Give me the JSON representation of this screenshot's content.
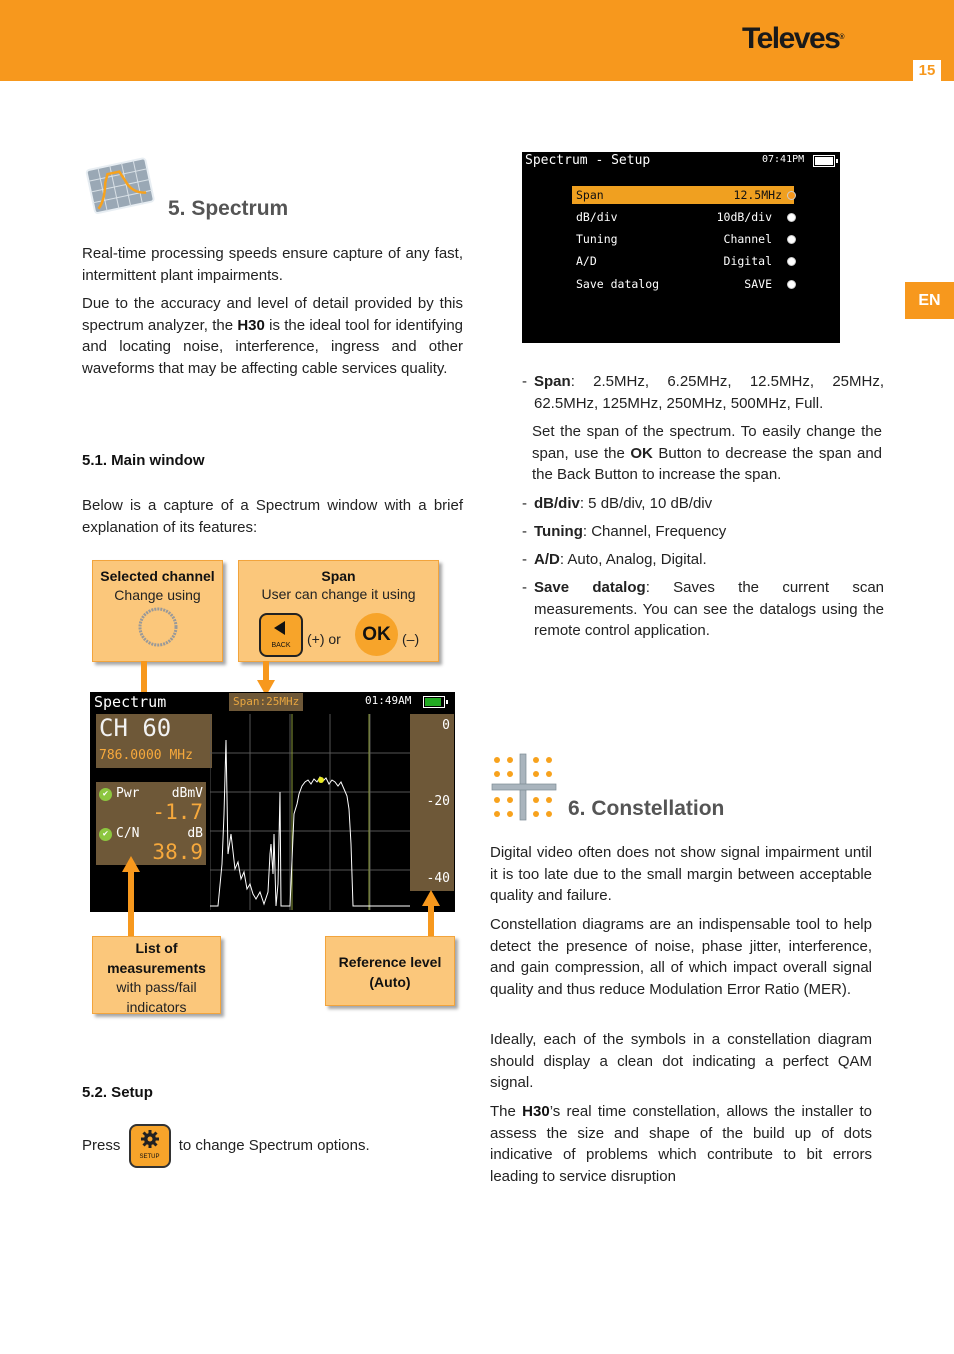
{
  "header": {
    "brand": "Televes",
    "registered": "®",
    "page_number": "15",
    "lang_tab": "EN",
    "accent_color": "#f7981d"
  },
  "section5": {
    "icon": "spectrum-icon",
    "title": "5. Spectrum",
    "para1": "Real-time processing speeds ensure capture of any fast, intermittent plant impairments.",
    "para2_pre": "Due to the accuracy and level of detail provided by this spectrum analyzer, the ",
    "para2_bold": "H30",
    "para2_post": " is the ideal tool for identifying and locating noise, interference, ingress and other waveforms that may be affecting cable services quality.",
    "sub1_title": "5.1. Main window",
    "sub1_text": "Below is a capture of a Spectrum window with a brief explanation of its features:",
    "callouts": {
      "selected_channel_title": "Selected channel",
      "selected_channel_text": "Change using",
      "span_title": "Span",
      "span_text": "User can change it using",
      "back_label": "BACK",
      "plus": "(+) or",
      "ok_label": "OK",
      "minus": "(–)",
      "list_title": "List of measurements",
      "list_text": "with pass/fail indicators",
      "ref_title": "Reference level (Auto)"
    },
    "screen": {
      "title": "Spectrum",
      "span": "Span:25MHz",
      "time": "01:49AM",
      "channel": "CH 60",
      "frequency": "786.0000 MHz",
      "pwr_label": "Pwr",
      "pwr_unit": "dBmV",
      "pwr_value": "-1.7",
      "cn_label": "C/N",
      "cn_unit": "dB",
      "cn_value": "38.9",
      "ref_levels": [
        "0",
        "-20",
        "-40"
      ]
    },
    "sub2_title": "5.2. Setup",
    "sub2_pre": "Press",
    "setup_key_label": "SETUP",
    "sub2_post": "to change Spectrum options."
  },
  "setup_screen": {
    "title": "Spectrum - Setup",
    "time": "07:41PM",
    "rows": [
      {
        "label": "Span",
        "value": "12.5MHz",
        "selected": true
      },
      {
        "label": "dB/div",
        "value": "10dB/div",
        "selected": false
      },
      {
        "label": "Tuning",
        "value": "Channel",
        "selected": false
      },
      {
        "label": "A/D",
        "value": "Digital",
        "selected": false
      },
      {
        "label": "Save datalog",
        "value": "SAVE",
        "selected": false
      }
    ]
  },
  "options": {
    "span_label": "Span",
    "span_text": ": 2.5MHz, 6.25MHz, 12.5MHz, 25MHz, 62.5MHz, 125MHz, 250MHz, 500MHz, Full.",
    "span_note_pre": "Set the span of the spectrum. To easily change the span, use the ",
    "span_note_bold": "OK",
    "span_note_post": " Button to decrease the span and the Back Button to increase the span.",
    "dbdiv_label": "dB/div",
    "dbdiv_text": ": 5 dB/div, 10 dB/div",
    "tuning_label": "Tuning",
    "tuning_text": ": Channel, Frequency",
    "ad_label": "A/D",
    "ad_text": ": Auto, Analog, Digital.",
    "save_label": "Save datalog",
    "save_text": ": Saves the current scan measurements. You can see the datalogs using the remote control application."
  },
  "section6": {
    "icon": "constellation-icon",
    "title": "6. Constellation",
    "para1": "Digital video often does not show signal impairment until it is too late due to the small margin between acceptable quality and failure.",
    "para2": "Constellation diagrams are an indispensable tool to help detect the presence of noise, phase jitter, interference, and gain compression, all of which impact overall signal quality and thus reduce Modulation Error Ratio (MER).",
    "para3": "Ideally, each of the symbols in a constellation diagram should display a clean dot indicating a perfect QAM signal.",
    "para4_pre": "The ",
    "para4_bold": "H30",
    "para4_post": "’s real time constellation, allows the installer to assess the size and shape of the build up of dots indicative of problems which contribute to bit errors leading to service disruption"
  }
}
